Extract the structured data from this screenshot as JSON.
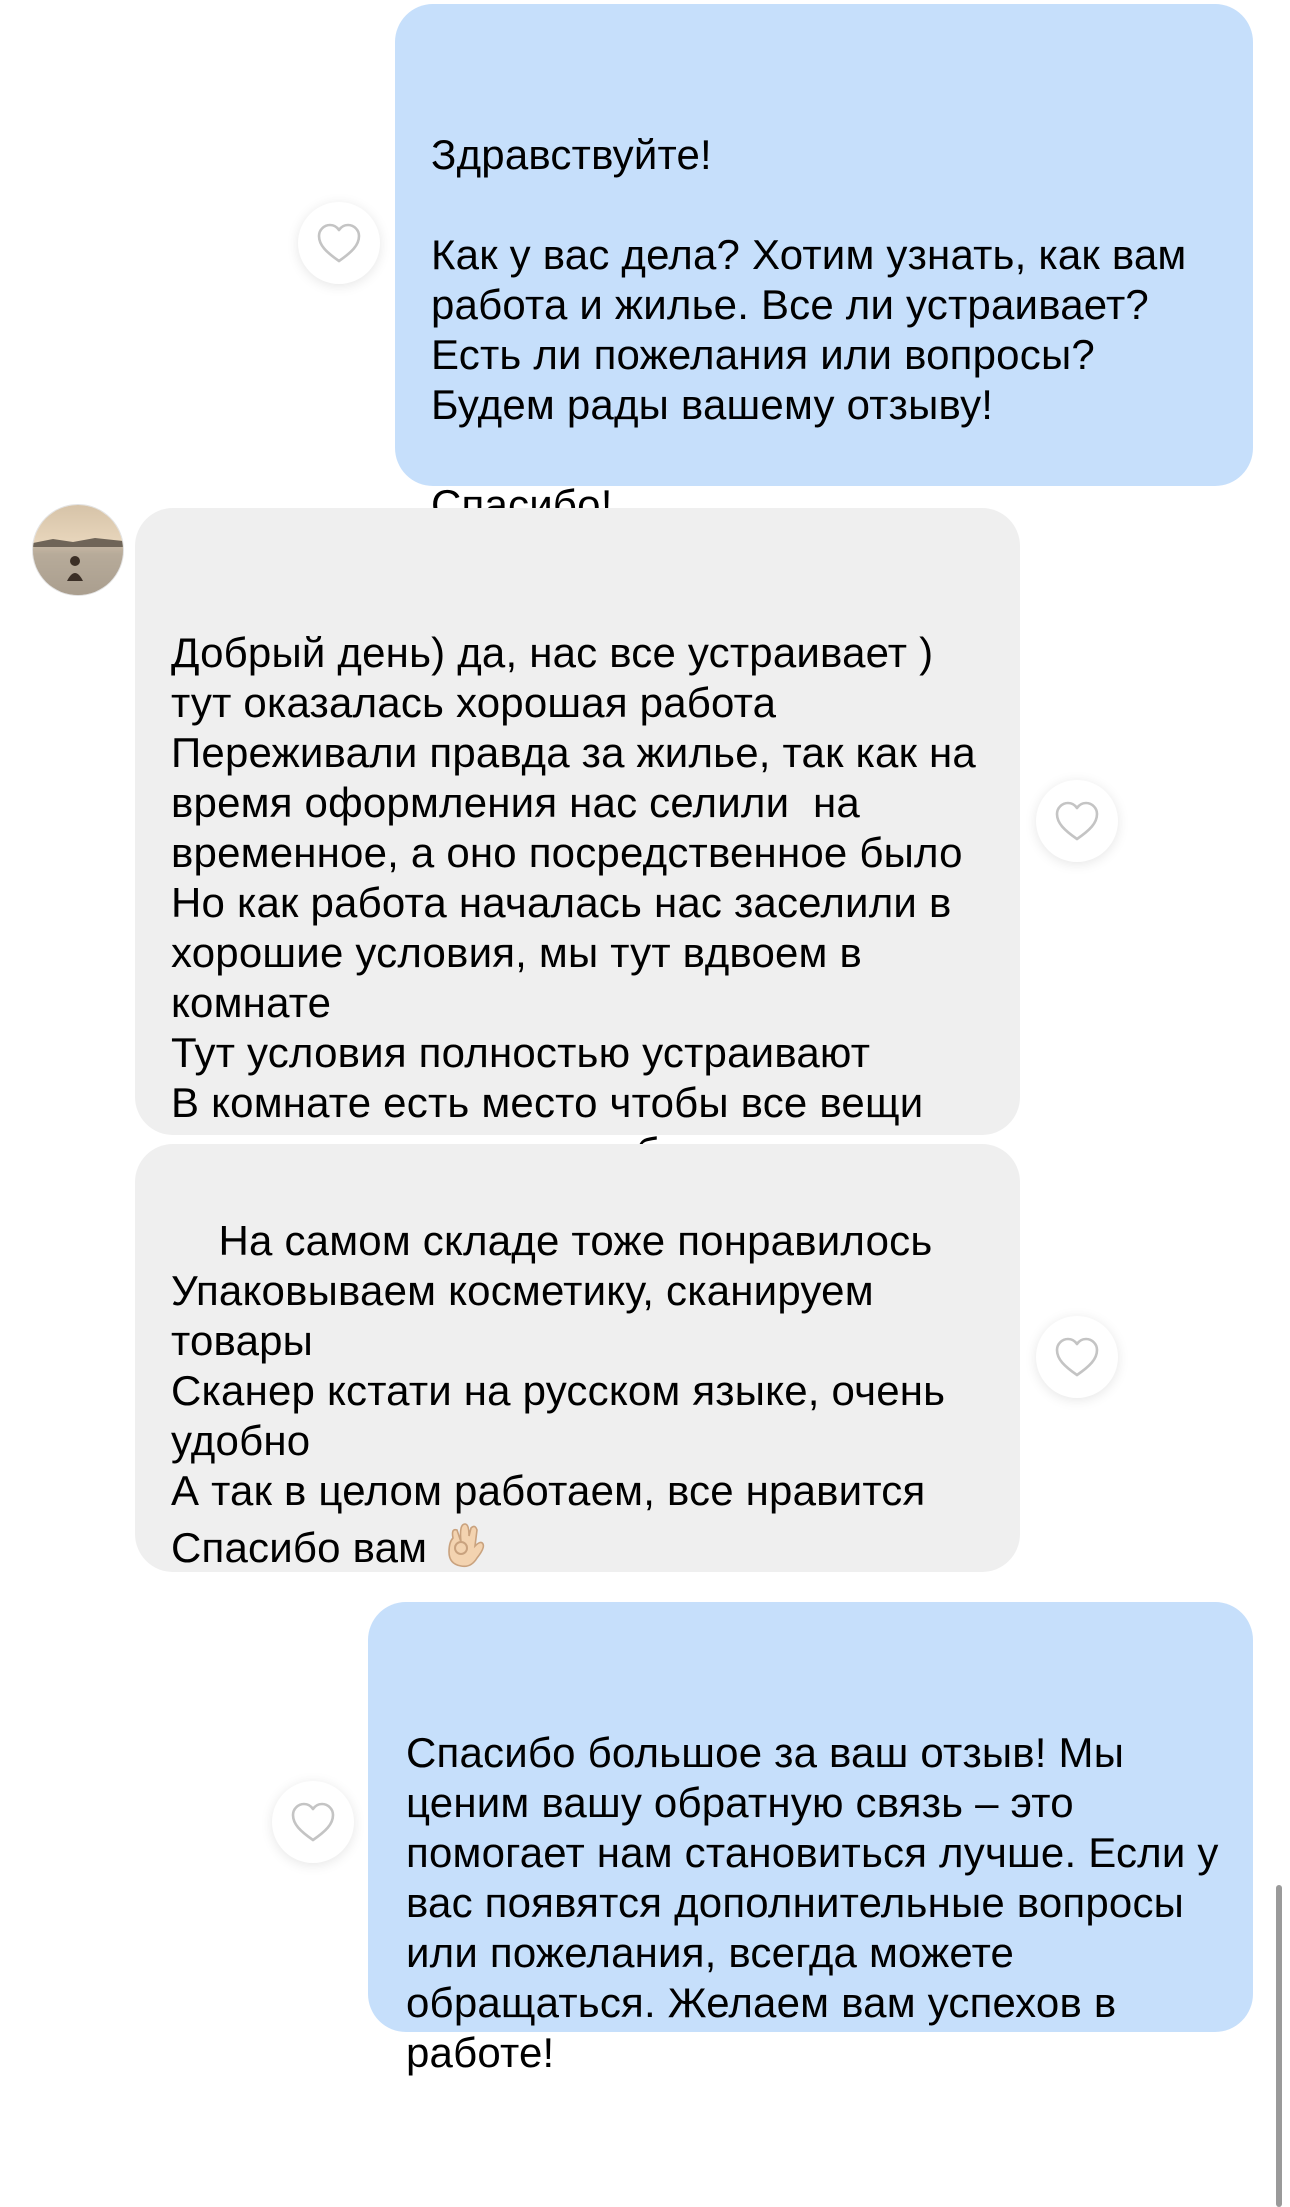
{
  "messages": [
    {
      "direction": "outgoing",
      "text": "Здравствуйте!\n\nКак у вас дела? Хотим узнать, как вам работа и жилье. Все ли устраивает? Есть ли пожелания или вопросы? Будем рады вашему отзыву!\n\nСпасибо!",
      "reaction_icon": "heart-outline-icon"
    },
    {
      "direction": "incoming",
      "text": "Добрый день) да, нас все устраивает )\nтут оказалась хорошая работа\nПереживали правда за жилье, так как на время оформления нас селили  на временное, а оно посредственное было\nНо как работа началась нас заселили в хорошие условия, мы тут вдвоем в комнате\nТут условия полностью устраивают\nВ комнате есть место чтобы все вещи разложить, кровати удобные",
      "reaction_icon": "heart-outline-icon"
    },
    {
      "direction": "incoming",
      "text": "На самом складе тоже понравилось\nУпаковываем косметику, сканируем товары\nСканер кстати на русском языке, очень удобно\nА так в целом работаем, все нравится\nСпасибо вам",
      "emoji": "ok-hand-emoji",
      "reaction_icon": "heart-outline-icon"
    },
    {
      "direction": "outgoing",
      "text": "Спасибо большое за ваш отзыв! Мы ценим вашу обратную связь – это помогает нам становиться лучше. Если у вас появятся дополнительные вопросы или пожелания, всегда можете обращаться. Желаем вам успехов в работе!",
      "reaction_icon": "heart-outline-icon"
    }
  ],
  "colors": {
    "outgoing_bubble": "#c6dffb",
    "incoming_bubble": "#efefef",
    "background": "#ffffff",
    "heart_stroke": "#c4c4c4"
  },
  "avatar": {
    "icon": "user-avatar-photo"
  }
}
